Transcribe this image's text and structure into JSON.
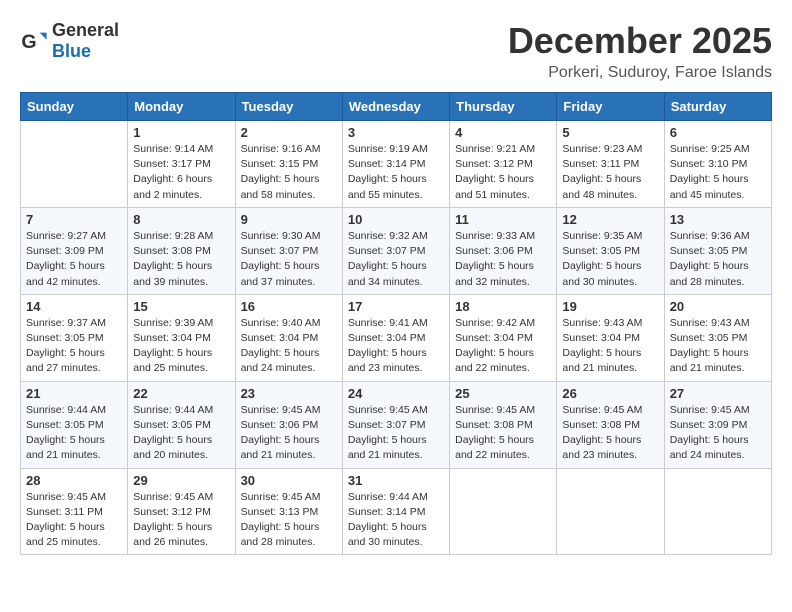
{
  "header": {
    "logo_general": "General",
    "logo_blue": "Blue",
    "month_title": "December 2025",
    "location": "Porkeri, Suduroy, Faroe Islands"
  },
  "weekdays": [
    "Sunday",
    "Monday",
    "Tuesday",
    "Wednesday",
    "Thursday",
    "Friday",
    "Saturday"
  ],
  "weeks": [
    [
      {
        "day": "",
        "info": ""
      },
      {
        "day": "1",
        "info": "Sunrise: 9:14 AM\nSunset: 3:17 PM\nDaylight: 6 hours\nand 2 minutes."
      },
      {
        "day": "2",
        "info": "Sunrise: 9:16 AM\nSunset: 3:15 PM\nDaylight: 5 hours\nand 58 minutes."
      },
      {
        "day": "3",
        "info": "Sunrise: 9:19 AM\nSunset: 3:14 PM\nDaylight: 5 hours\nand 55 minutes."
      },
      {
        "day": "4",
        "info": "Sunrise: 9:21 AM\nSunset: 3:12 PM\nDaylight: 5 hours\nand 51 minutes."
      },
      {
        "day": "5",
        "info": "Sunrise: 9:23 AM\nSunset: 3:11 PM\nDaylight: 5 hours\nand 48 minutes."
      },
      {
        "day": "6",
        "info": "Sunrise: 9:25 AM\nSunset: 3:10 PM\nDaylight: 5 hours\nand 45 minutes."
      }
    ],
    [
      {
        "day": "7",
        "info": "Sunrise: 9:27 AM\nSunset: 3:09 PM\nDaylight: 5 hours\nand 42 minutes."
      },
      {
        "day": "8",
        "info": "Sunrise: 9:28 AM\nSunset: 3:08 PM\nDaylight: 5 hours\nand 39 minutes."
      },
      {
        "day": "9",
        "info": "Sunrise: 9:30 AM\nSunset: 3:07 PM\nDaylight: 5 hours\nand 37 minutes."
      },
      {
        "day": "10",
        "info": "Sunrise: 9:32 AM\nSunset: 3:07 PM\nDaylight: 5 hours\nand 34 minutes."
      },
      {
        "day": "11",
        "info": "Sunrise: 9:33 AM\nSunset: 3:06 PM\nDaylight: 5 hours\nand 32 minutes."
      },
      {
        "day": "12",
        "info": "Sunrise: 9:35 AM\nSunset: 3:05 PM\nDaylight: 5 hours\nand 30 minutes."
      },
      {
        "day": "13",
        "info": "Sunrise: 9:36 AM\nSunset: 3:05 PM\nDaylight: 5 hours\nand 28 minutes."
      }
    ],
    [
      {
        "day": "14",
        "info": "Sunrise: 9:37 AM\nSunset: 3:05 PM\nDaylight: 5 hours\nand 27 minutes."
      },
      {
        "day": "15",
        "info": "Sunrise: 9:39 AM\nSunset: 3:04 PM\nDaylight: 5 hours\nand 25 minutes."
      },
      {
        "day": "16",
        "info": "Sunrise: 9:40 AM\nSunset: 3:04 PM\nDaylight: 5 hours\nand 24 minutes."
      },
      {
        "day": "17",
        "info": "Sunrise: 9:41 AM\nSunset: 3:04 PM\nDaylight: 5 hours\nand 23 minutes."
      },
      {
        "day": "18",
        "info": "Sunrise: 9:42 AM\nSunset: 3:04 PM\nDaylight: 5 hours\nand 22 minutes."
      },
      {
        "day": "19",
        "info": "Sunrise: 9:43 AM\nSunset: 3:04 PM\nDaylight: 5 hours\nand 21 minutes."
      },
      {
        "day": "20",
        "info": "Sunrise: 9:43 AM\nSunset: 3:05 PM\nDaylight: 5 hours\nand 21 minutes."
      }
    ],
    [
      {
        "day": "21",
        "info": "Sunrise: 9:44 AM\nSunset: 3:05 PM\nDaylight: 5 hours\nand 21 minutes."
      },
      {
        "day": "22",
        "info": "Sunrise: 9:44 AM\nSunset: 3:05 PM\nDaylight: 5 hours\nand 20 minutes."
      },
      {
        "day": "23",
        "info": "Sunrise: 9:45 AM\nSunset: 3:06 PM\nDaylight: 5 hours\nand 21 minutes."
      },
      {
        "day": "24",
        "info": "Sunrise: 9:45 AM\nSunset: 3:07 PM\nDaylight: 5 hours\nand 21 minutes."
      },
      {
        "day": "25",
        "info": "Sunrise: 9:45 AM\nSunset: 3:08 PM\nDaylight: 5 hours\nand 22 minutes."
      },
      {
        "day": "26",
        "info": "Sunrise: 9:45 AM\nSunset: 3:08 PM\nDaylight: 5 hours\nand 23 minutes."
      },
      {
        "day": "27",
        "info": "Sunrise: 9:45 AM\nSunset: 3:09 PM\nDaylight: 5 hours\nand 24 minutes."
      }
    ],
    [
      {
        "day": "28",
        "info": "Sunrise: 9:45 AM\nSunset: 3:11 PM\nDaylight: 5 hours\nand 25 minutes."
      },
      {
        "day": "29",
        "info": "Sunrise: 9:45 AM\nSunset: 3:12 PM\nDaylight: 5 hours\nand 26 minutes."
      },
      {
        "day": "30",
        "info": "Sunrise: 9:45 AM\nSunset: 3:13 PM\nDaylight: 5 hours\nand 28 minutes."
      },
      {
        "day": "31",
        "info": "Sunrise: 9:44 AM\nSunset: 3:14 PM\nDaylight: 5 hours\nand 30 minutes."
      },
      {
        "day": "",
        "info": ""
      },
      {
        "day": "",
        "info": ""
      },
      {
        "day": "",
        "info": ""
      }
    ]
  ]
}
